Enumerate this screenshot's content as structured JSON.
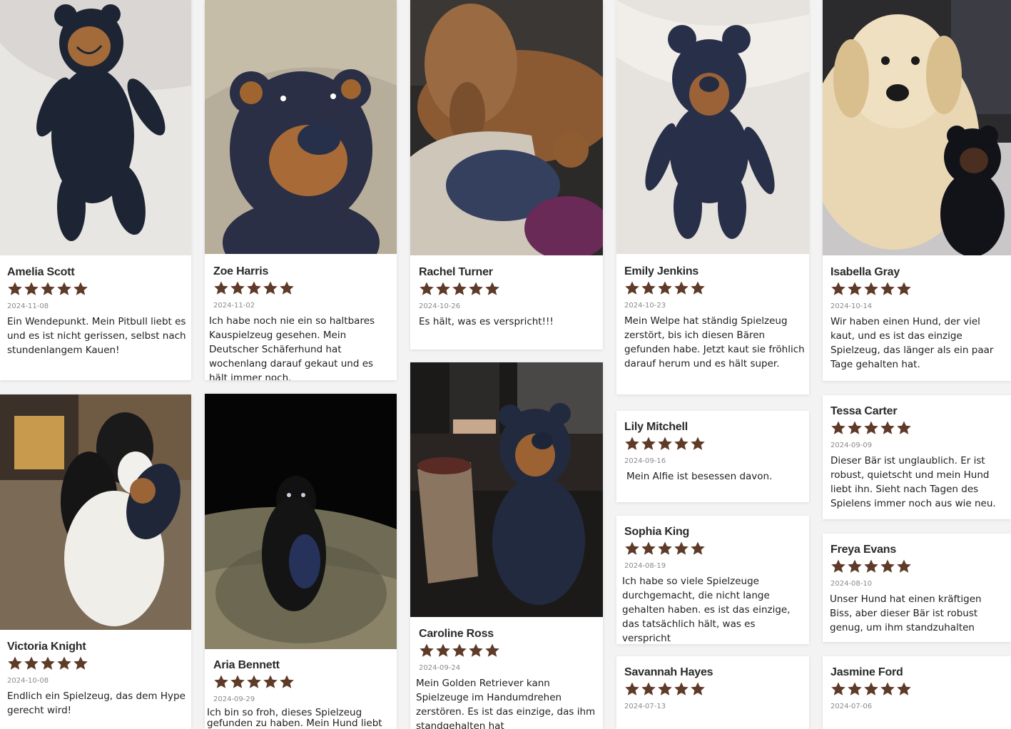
{
  "page": {
    "star_color": "#5e3a28"
  },
  "reviews": [
    {
      "name": "Amelia Scott",
      "rating": 5,
      "date": "2024-11-08",
      "text": "Ein Wendepunkt. Mein Pitbull liebt es und es ist nicht gerissen, selbst nach stundenlangem Kauen!"
    },
    {
      "name": "Zoe Harris",
      "rating": 5,
      "date": "2024-11-02",
      "text": "Ich habe noch nie ein so haltbares Kauspielzeug gesehen. Mein Deutscher Schäferhund hat wochenlang darauf gekaut und es hält immer noch."
    },
    {
      "name": "Rachel Turner",
      "rating": 5,
      "date": "2024-10-26",
      "text": "Es hält, was es verspricht!!!"
    },
    {
      "name": "Emily Jenkins",
      "rating": 5,
      "date": "2024-10-23",
      "text": "Mein Welpe hat ständig Spielzeug zerstört, bis ich diesen Bären gefunden habe. Jetzt kaut sie fröhlich darauf herum und es hält super."
    },
    {
      "name": "Isabella Gray",
      "rating": 5,
      "date": "2024-10-14",
      "text": "Wir haben einen Hund, der viel kaut, und es ist das einzige Spielzeug, das länger als ein paar Tage gehalten hat."
    },
    {
      "name": "Victoria Knight",
      "rating": 5,
      "date": "2024-10-08",
      "text": "Endlich ein Spielzeug, das dem Hype gerecht wird!"
    },
    {
      "name": "Aria Bennett",
      "rating": 5,
      "date": "2024-09-29",
      "text": "Ich bin so froh, dieses Spielzeug gefunden zu haben. Mein Hund liebt es"
    },
    {
      "name": "Caroline Ross",
      "rating": 5,
      "date": "2024-09-24",
      "text": "Mein Golden Retriever kann Spielzeuge im Handumdrehen zerstören. Es ist das einzige, das ihm standgehalten hat"
    },
    {
      "name": "Lily Mitchell",
      "rating": 5,
      "date": "2024-09-16",
      "text": "Mein Alfie ist besessen davon."
    },
    {
      "name": "Sophia King",
      "rating": 5,
      "date": "2024-08-19",
      "text": "Ich habe so viele Spielzeuge durchgemacht, die nicht lange gehalten haben. es ist das einzige, das tatsächlich hält, was es verspricht"
    },
    {
      "name": "Savannah Hayes",
      "rating": 5,
      "date": "2024-07-13",
      "text": ""
    },
    {
      "name": "Tessa Carter",
      "rating": 5,
      "date": "2024-09-09",
      "text": "Dieser Bär ist unglaublich. Er ist robust, quietscht und mein Hund liebt ihn. Sieht nach Tagen des Spielens immer noch aus wie neu."
    },
    {
      "name": "Freya Evans",
      "rating": 5,
      "date": "2024-08-10",
      "text": "Unser Hund hat einen kräftigen Biss, aber dieser Bär ist robust genug, um ihm standzuhalten"
    },
    {
      "name": "Jasmine Ford",
      "rating": 5,
      "date": "2024-07-06",
      "text": ""
    }
  ]
}
